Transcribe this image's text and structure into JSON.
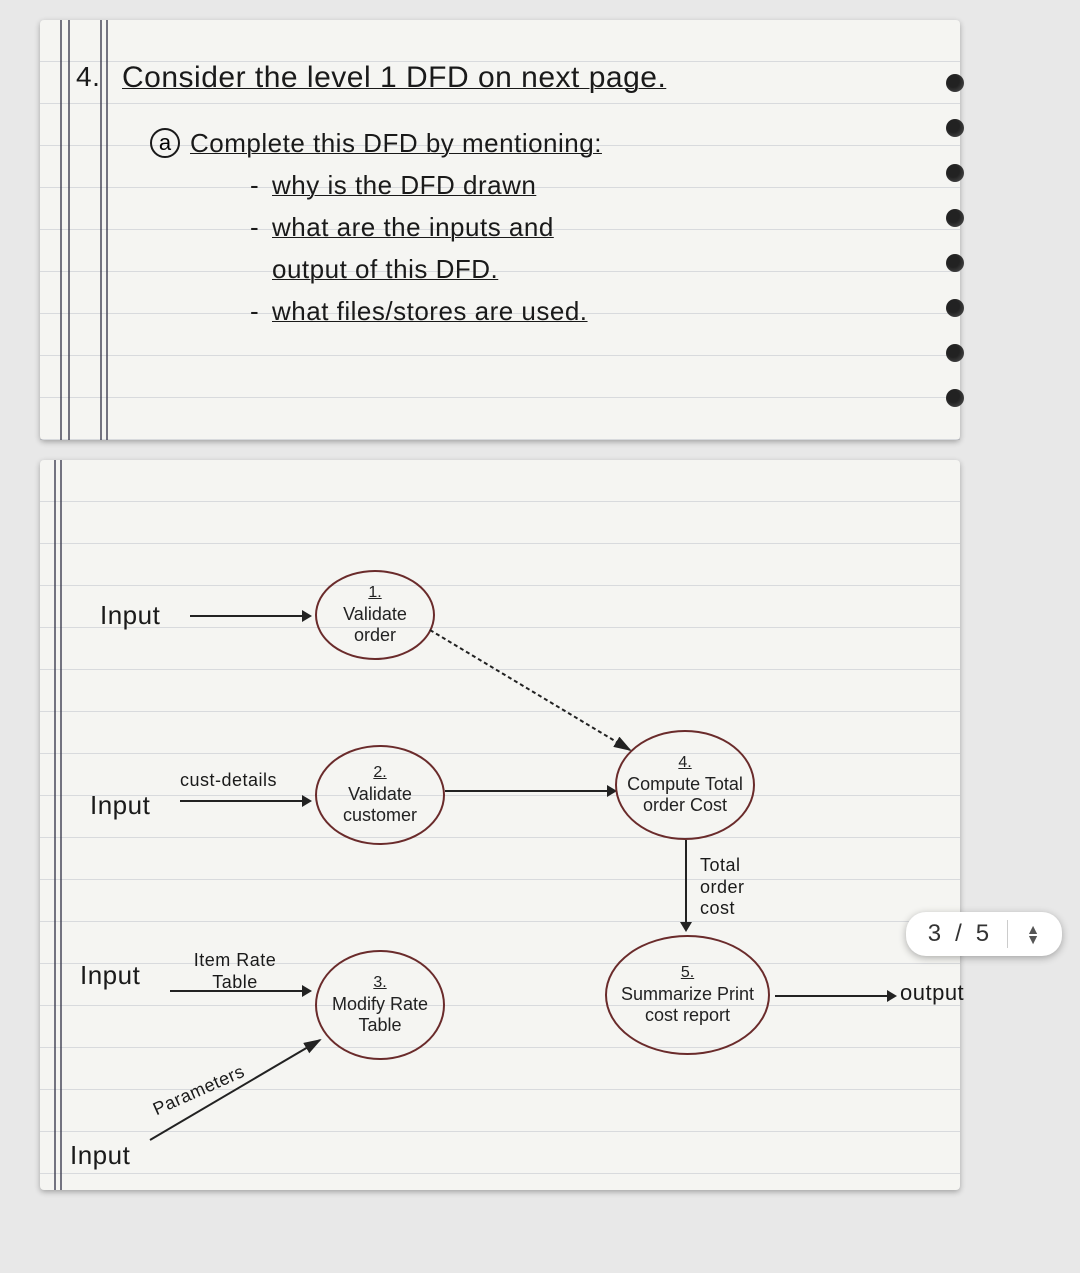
{
  "question": {
    "number": "4.",
    "title": "Consider the level 1 DFD on next page.",
    "part_a_label": "a",
    "part_a_text": "Complete this DFD by mentioning:",
    "bullets": [
      "why is the DFD drawn",
      "what are the inputs and output of this DFD.",
      "what files/stores are used."
    ]
  },
  "dfd": {
    "inputs": {
      "in1": "Input",
      "in2": "Input",
      "in2_label": "cust-details",
      "in3": "Input",
      "in3_label": "Item Rate Table",
      "in4": "Input",
      "in4_label": "Parameters"
    },
    "processes": {
      "p1": {
        "num": "1.",
        "name": "Validate order"
      },
      "p2": {
        "num": "2.",
        "name": "Validate customer"
      },
      "p3": {
        "num": "3.",
        "name": "Modify Rate Table"
      },
      "p4": {
        "num": "4.",
        "name": "Compute Total order Cost"
      },
      "p5": {
        "num": "5.",
        "name": "Summarize Print cost report"
      }
    },
    "flows": {
      "f45": "Total order cost"
    },
    "output": "output"
  },
  "pager": {
    "current": "3",
    "sep": "/",
    "total": "5"
  }
}
